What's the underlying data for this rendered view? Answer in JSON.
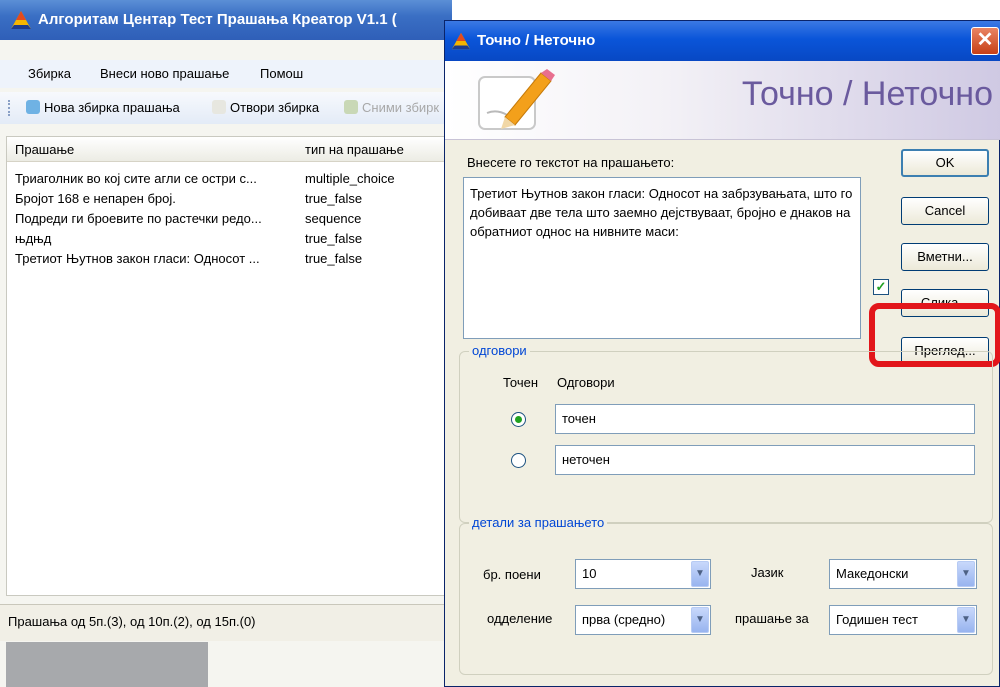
{
  "main_window": {
    "title": "Алгоритам Центар Тест Прашања Креатор V1.1 (",
    "menu": [
      "Збирка",
      "Внеси ново прашање",
      "Помош"
    ],
    "toolbar": [
      "Нова збирка прашања",
      "Отвори збирка",
      "Сними збирк"
    ],
    "list": {
      "columns": [
        "Прашање",
        "тип на прашање"
      ],
      "rows": [
        {
          "question": "Триаголник во кој сите агли се остри с...",
          "type": "multiple_choice"
        },
        {
          "question": "Бројот 168 е непарен број.",
          "type": "true_false"
        },
        {
          "question": "Подреди ги броевите по растечки редо...",
          "type": "sequence"
        },
        {
          "question": "њдњд",
          "type": "true_false"
        },
        {
          "question": "Третиот Њутнов закон гласи: Односот ...",
          "type": "true_false"
        }
      ]
    },
    "status": "Прашања од 5п.(3), од 10п.(2), од 15п.(0)"
  },
  "dialog": {
    "title": "Точно / Неточно",
    "banner_title": "Точно / Неточно",
    "question_label": "Внесете го текстот на прашањето:",
    "question_text": "Третиот Њутнов закон гласи: Односот на забрзувањата, што го добиваат две тела што заемно дејствуваат, бројно е днаков на обратниот однос на нивните маси:",
    "buttons": {
      "ok": "OK",
      "cancel": "Cancel",
      "insert": "Вметни...",
      "image": "Слика...",
      "preview": "Преглед..."
    },
    "image_checked": true,
    "answers": {
      "legend": "одговори",
      "col_correct": "Точен",
      "col_answers": "Одговори",
      "items": [
        {
          "text": "точен",
          "selected": true
        },
        {
          "text": "неточен",
          "selected": false
        }
      ]
    },
    "details": {
      "legend": "детали за прашањето",
      "points_label": "бр. поени",
      "points_value": "10",
      "language_label": "Јазик",
      "language_value": "Македонски",
      "grade_label": "одделение",
      "grade_value": "прва (средно)",
      "question_for_label": "прашање за",
      "question_for_value": "Годишен тест"
    }
  },
  "colors": {
    "highlight": "#e2161b",
    "xp_blue": "#0a55d9",
    "banner_text": "#6a5a9e"
  }
}
